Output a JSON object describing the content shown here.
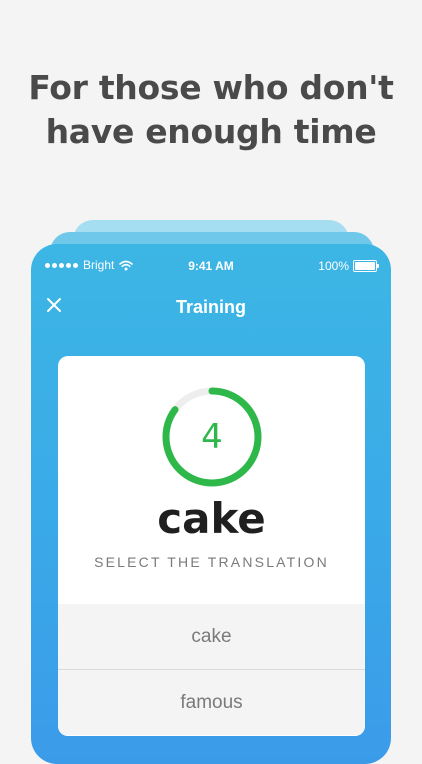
{
  "headline": {
    "line1": "For those who don't",
    "line2": "have enough time"
  },
  "status_bar": {
    "carrier": "Bright",
    "time": "9:41 AM",
    "battery": "100%"
  },
  "nav": {
    "title": "Training",
    "close_icon": "close-icon"
  },
  "quiz": {
    "timer_value": "4",
    "timer_progress": 0.85,
    "word": "cake",
    "instruction": "SELECT THE TRANSLATION",
    "options": [
      "cake",
      "famous"
    ]
  },
  "colors": {
    "background": "#f4f4f4",
    "phone_gradient_top": "#3cb6e4",
    "phone_gradient_bottom": "#3b9be9",
    "timer_green": "#2eb84a"
  }
}
